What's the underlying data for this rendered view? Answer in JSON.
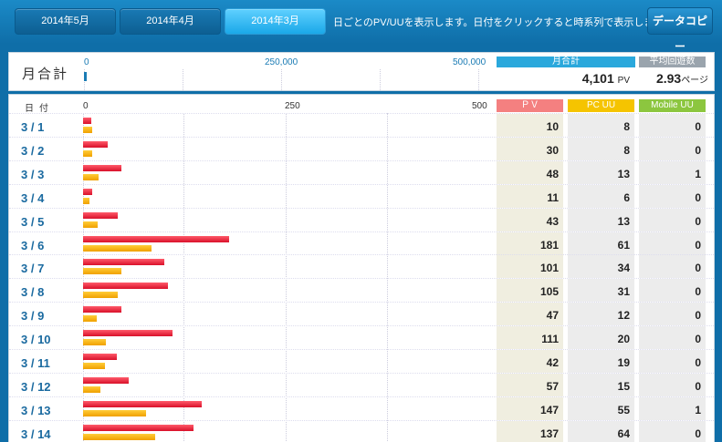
{
  "tabs": [
    {
      "label": "2014年5月",
      "active": false
    },
    {
      "label": "2014年4月",
      "active": false
    },
    {
      "label": "2014年3月",
      "active": true
    }
  ],
  "hint_text": "日ごとのPV/UUを表示します。日付をクリックすると時系列で表示します。",
  "copy_button": "データコピー",
  "summary": {
    "label": "月合計",
    "axis_ticks": [
      "0",
      "250,000",
      "500,000"
    ],
    "total_pv_value": 4101,
    "total_head": "月合計",
    "total_value": "4,101",
    "total_unit": "PV",
    "avg_head": "平均回遊数",
    "avg_value": "2.93",
    "avg_unit": "ページ"
  },
  "table": {
    "date_header": "日付",
    "axis_ticks": [
      "0",
      "250",
      "500"
    ],
    "axis_max": 500,
    "headers": {
      "pv": "ＰＶ",
      "pc": "PC UU",
      "mobile": "Mobile UU"
    },
    "rows": [
      {
        "date": "3 / 1",
        "pv": "10",
        "pc": "8",
        "mobile": "0"
      },
      {
        "date": "3 / 2",
        "pv": "30",
        "pc": "8",
        "mobile": "0"
      },
      {
        "date": "3 / 3",
        "pv": "48",
        "pc": "13",
        "mobile": "1"
      },
      {
        "date": "3 / 4",
        "pv": "11",
        "pc": "6",
        "mobile": "0"
      },
      {
        "date": "3 / 5",
        "pv": "43",
        "pc": "13",
        "mobile": "0"
      },
      {
        "date": "3 / 6",
        "pv": "181",
        "pc": "61",
        "mobile": "0"
      },
      {
        "date": "3 / 7",
        "pv": "101",
        "pc": "34",
        "mobile": "0"
      },
      {
        "date": "3 / 8",
        "pv": "105",
        "pc": "31",
        "mobile": "0"
      },
      {
        "date": "3 / 9",
        "pv": "47",
        "pc": "12",
        "mobile": "0"
      },
      {
        "date": "3 / 10",
        "pv": "111",
        "pc": "20",
        "mobile": "0"
      },
      {
        "date": "3 / 11",
        "pv": "42",
        "pc": "19",
        "mobile": "0"
      },
      {
        "date": "3 / 12",
        "pv": "57",
        "pc": "15",
        "mobile": "0"
      },
      {
        "date": "3 / 13",
        "pv": "147",
        "pc": "55",
        "mobile": "1"
      },
      {
        "date": "3 / 14",
        "pv": "137",
        "pc": "64",
        "mobile": "0"
      }
    ]
  },
  "colors": {
    "pv": "#e8213a",
    "uu": "#f5b000",
    "pv_header": "#f48080",
    "pc_header": "#f5c400",
    "mobile_header": "#8cc63f",
    "summary_head": "#2aa8dc",
    "avg_head": "#9aa4ad"
  }
}
